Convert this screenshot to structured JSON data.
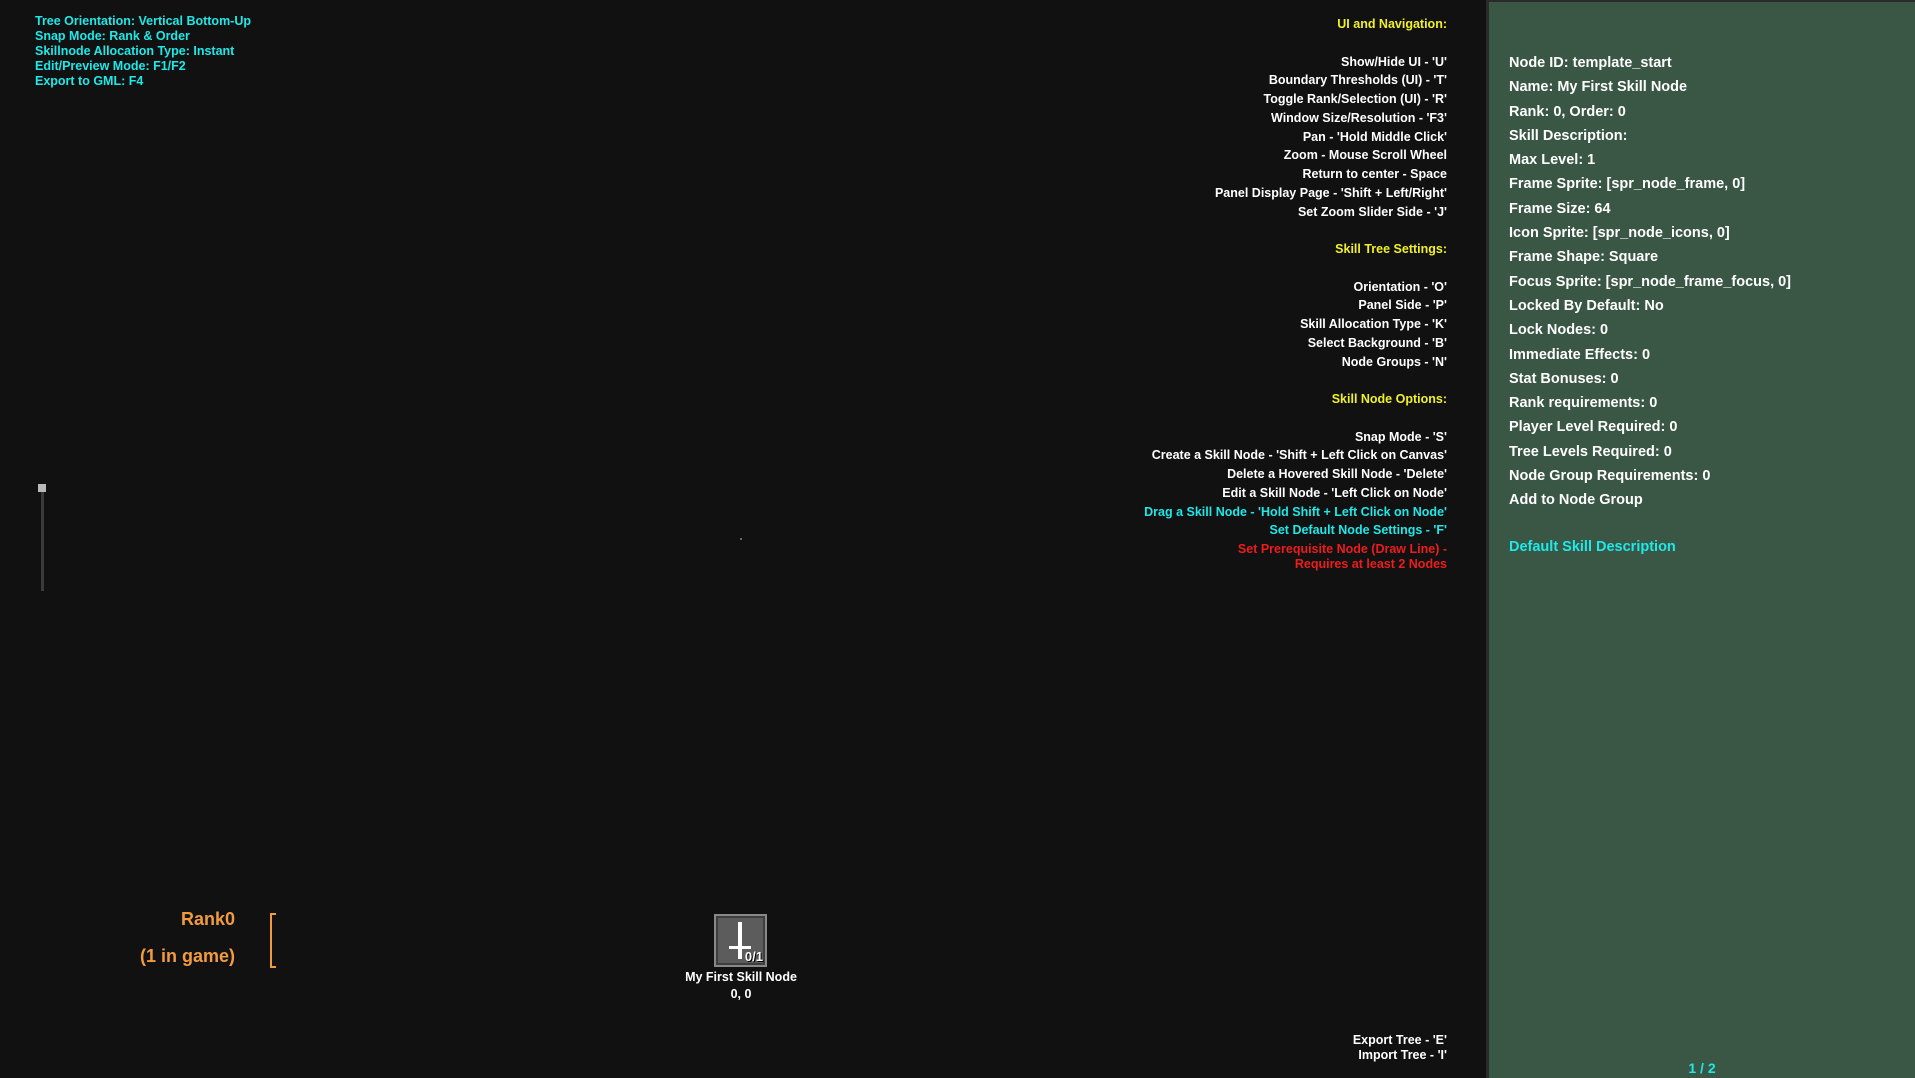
{
  "status": {
    "lines": [
      "Tree Orientation: Vertical Bottom-Up",
      "Snap Mode: Rank & Order",
      "Skillnode Allocation Type: Instant",
      "Edit/Preview Mode: F1/F2",
      "Export to GML: F4"
    ]
  },
  "help": {
    "ui_header": "UI and Navigation:",
    "ui_items": [
      "Show/Hide UI - 'U'",
      "Boundary Thresholds (UI) - 'T'",
      "Toggle Rank/Selection (UI) - 'R'",
      "Window Size/Resolution - 'F3'",
      "Pan - 'Hold Middle Click'",
      "Zoom - Mouse Scroll Wheel",
      "Return to center - Space",
      "Panel Display Page - 'Shift + Left/Right'",
      "Set Zoom Slider Side - 'J'"
    ],
    "tree_header": "Skill Tree Settings:",
    "tree_items": [
      "Orientation - 'O'",
      "Panel Side - 'P'",
      "Skill Allocation Type - 'K'",
      "Select Background - 'B'",
      "Node Groups - 'N'"
    ],
    "node_header": "Skill Node Options:",
    "node_items": [
      "Snap Mode - 'S'",
      "Create a Skill Node - 'Shift + Left Click on Canvas'",
      "Delete a Hovered Skill Node - 'Delete'",
      "Edit a Skill Node - 'Left Click on Node'"
    ],
    "drag_item": "Drag a Skill Node - 'Hold Shift + Left Click on Node'",
    "default_item": "Set Default Node Settings - 'F'",
    "prereq_line1": "Set Prerequisite Node (Draw Line) -",
    "prereq_line2": "Requires at least 2 Nodes"
  },
  "rank": {
    "label": "Rank0",
    "count": "(1 in game)"
  },
  "node": {
    "icon": "sword-icon",
    "level": "0/1",
    "name": "My First Skill Node",
    "coords": "0, 0"
  },
  "io": {
    "export": "Export Tree - 'E'",
    "import": "Import Tree - 'I'"
  },
  "panel": {
    "fields": [
      "Node ID: template_start",
      "Name: My First Skill Node",
      "Rank: 0, Order: 0",
      "Skill Description:",
      "Max Level: 1",
      "Frame Sprite: [spr_node_frame, 0]",
      "Frame Size: 64",
      "Icon Sprite: [spr_node_icons, 0]",
      "Frame Shape: Square",
      "Focus Sprite: [spr_node_frame_focus, 0]",
      "Locked By Default: No",
      "Lock Nodes: 0",
      "Immediate Effects: 0",
      "Stat Bonuses: 0",
      "Rank requirements: 0",
      "Player Level Required: 0",
      "Tree Levels Required: 0",
      "Node Group Requirements: 0",
      "Add to Node Group"
    ],
    "description": "Default Skill Description",
    "page": "1 / 2"
  },
  "colors": {
    "background": "#111111",
    "panel": "#3a5645",
    "cyan": "#1ee8e8",
    "yellow": "#f0f02a",
    "red": "#ee1c1c",
    "orange": "#f29b3e"
  }
}
